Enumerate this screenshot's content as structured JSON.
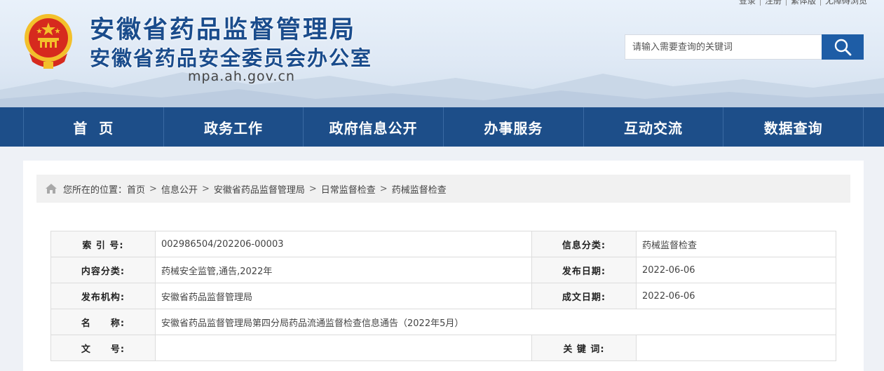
{
  "header": {
    "top_links": [
      "登录",
      "注册",
      "繁体版",
      "无障碍浏览"
    ],
    "title_line1": "安徽省药品监督管理局",
    "title_line2": "安徽省药品安全委员会办公室",
    "domain": "mpa.ah.gov.cn",
    "search": {
      "placeholder": "请输入需要查询的关键词",
      "button_icon": "search-icon"
    }
  },
  "nav": {
    "items": [
      {
        "label": "首  页"
      },
      {
        "label": "政务工作"
      },
      {
        "label": "政府信息公开"
      },
      {
        "label": "办事服务"
      },
      {
        "label": "互动交流"
      },
      {
        "label": "数据查询"
      }
    ]
  },
  "breadcrumb": {
    "prefix": "您所在的位置：",
    "items": [
      "首页",
      "信息公开",
      "安徽省药品监督管理局",
      "日常监督检查",
      "药械监督检查"
    ],
    "separator": ">"
  },
  "info_table": {
    "rows": [
      {
        "label1": "索 引 号:",
        "value1": "002986504/202206-00003",
        "label2": "信息分类:",
        "value2": "药械监督检查"
      },
      {
        "label1": "内容分类:",
        "value1": "药械安全监管,通告,2022年",
        "label2": "发布日期:",
        "value2": "2022-06-06"
      },
      {
        "label1": "发布机构:",
        "value1": "安徽省药品监督管理局",
        "label2": "成文日期:",
        "value2": "2022-06-06"
      },
      {
        "label1": "名　　称:",
        "value1": "安徽省药品监督管理局第四分局药品流通监督检查信息通告（2022年5月）"
      },
      {
        "label1": "文　　号:",
        "value1": "",
        "label2": "关 键 词:",
        "value2": ""
      }
    ]
  },
  "colors": {
    "nav_bg": "#1d4e89",
    "title_blue": "#1a4c8c",
    "search_button": "#1e5da6",
    "emblem_red": "#d62a1e",
    "emblem_gold": "#f3c02b"
  }
}
